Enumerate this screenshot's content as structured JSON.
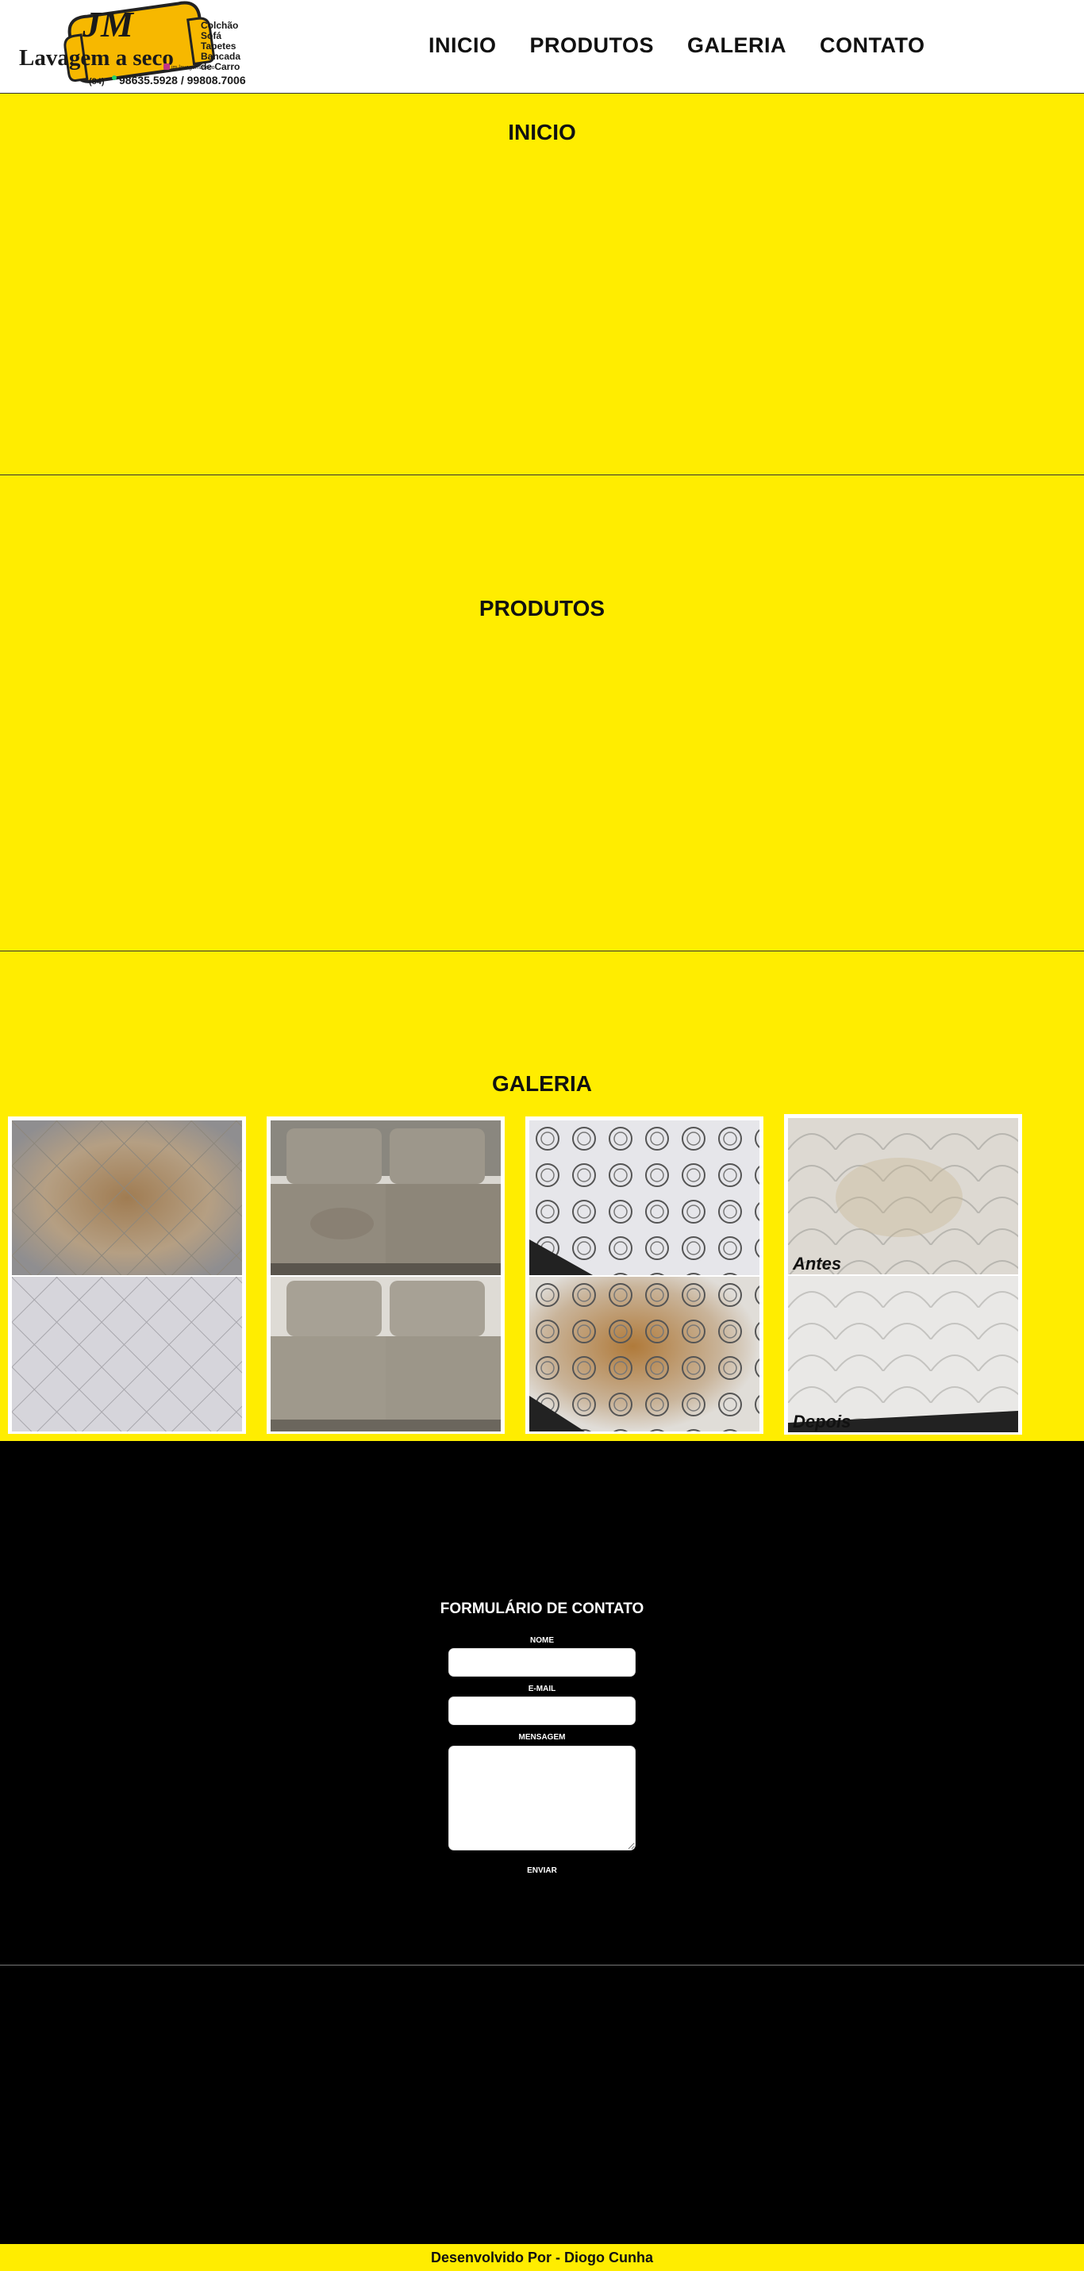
{
  "header": {
    "logo": {
      "brand": "JM",
      "tagline": "Lavagem a seco",
      "services": [
        "Colchão",
        "Sofá",
        "Tapetes",
        "Bancada",
        "de Carro"
      ],
      "instagram": "jm.lavagemaseco",
      "area_code": "(84)",
      "phones": "98635.5928 / 99808.7006"
    },
    "nav": [
      "INICIO",
      "PRODUTOS",
      "GALERIA",
      "CONTATO"
    ]
  },
  "sections": {
    "inicio": {
      "title": "INICIO"
    },
    "produtos": {
      "title": "PRODUTOS"
    },
    "galeria": {
      "title": "GALERIA",
      "labels": {
        "before": "Antes",
        "after": "Depois"
      }
    }
  },
  "contact": {
    "title": "FORMULÁRIO DE CONTATO",
    "name_label": "NOME",
    "email_label": "E-MAIL",
    "message_label": "MENSAGEM",
    "submit_label": "ENVIAR"
  },
  "footer": {
    "text": "Desenvolvido Por - Diogo Cunha"
  },
  "colors": {
    "accent": "#ffed00",
    "dark": "#000000",
    "text": "#111111"
  }
}
